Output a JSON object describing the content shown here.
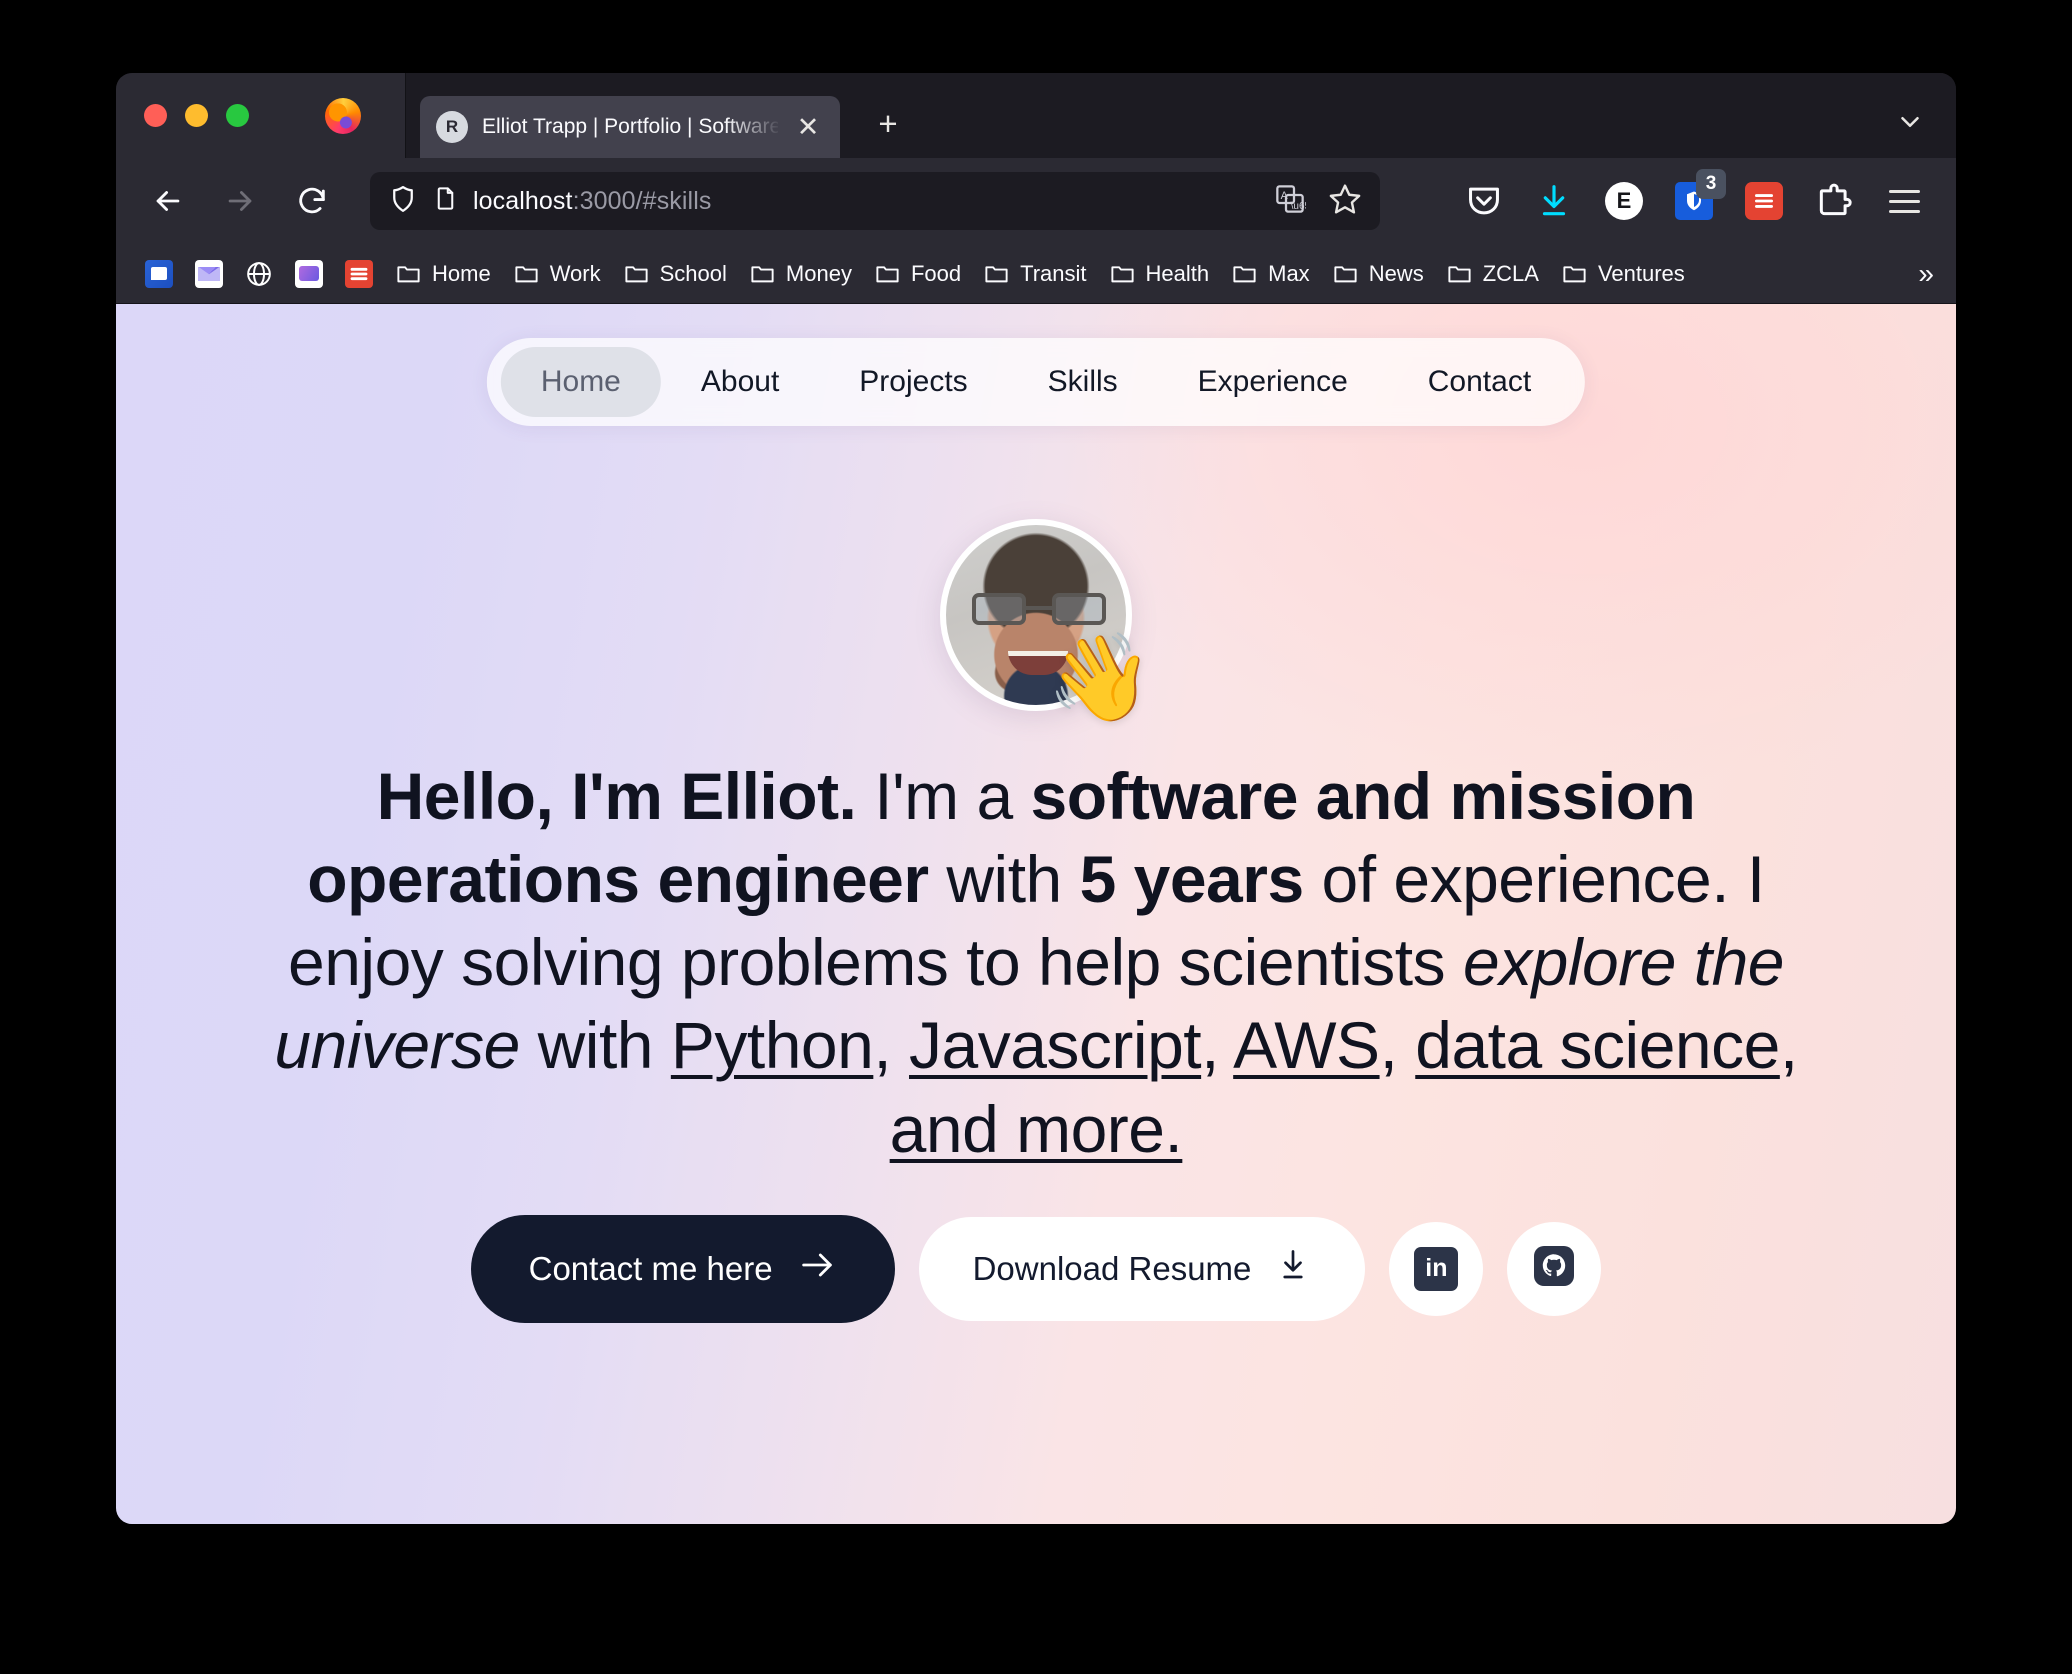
{
  "browser": {
    "window_controls": [
      "close",
      "minimize",
      "maximize"
    ],
    "tab": {
      "favicon_letter": "R",
      "title": "Elliot Trapp | Portfolio | Software",
      "close_label": "✕"
    },
    "new_tab_label": "+",
    "list_all_tabs_label": "⌄",
    "nav": {
      "back": "←",
      "forward": "→",
      "reload": "↻"
    },
    "url": {
      "host": "localhost",
      "rest": ":3000/#skills",
      "full": "localhost:3000/#skills"
    },
    "toolbar_icons": [
      {
        "name": "pocket-icon",
        "label": "Pocket"
      },
      {
        "name": "downloads-icon",
        "label": "Downloads"
      },
      {
        "name": "account-avatar",
        "label": "E"
      },
      {
        "name": "bitwarden-icon",
        "label": "Bitwarden",
        "badge": "3"
      },
      {
        "name": "todoist-icon",
        "label": "Todoist"
      },
      {
        "name": "extensions-icon",
        "label": "Extensions"
      },
      {
        "name": "app-menu-icon",
        "label": "Open application menu"
      }
    ],
    "bookmarks": {
      "favicons": [
        "slack-icon",
        "gmail-icon",
        "globe-icon",
        "photos-icon",
        "todoist-icon"
      ],
      "folders": [
        "Home",
        "Work",
        "School",
        "Money",
        "Food",
        "Transit",
        "Health",
        "Max",
        "News",
        "ZCLA",
        "Ventures"
      ],
      "overflow_label": "»"
    }
  },
  "site": {
    "nav": [
      {
        "label": "Home",
        "active": true
      },
      {
        "label": "About",
        "active": false
      },
      {
        "label": "Projects",
        "active": false
      },
      {
        "label": "Skills",
        "active": false
      },
      {
        "label": "Experience",
        "active": false
      },
      {
        "label": "Contact",
        "active": false
      }
    ],
    "avatar": {
      "emoji": "👋",
      "alt": "profile-photo"
    },
    "headline": {
      "p1": "Hello, I'm Elliot.",
      "p2": " I'm a ",
      "p3": "software and mission operations engineer",
      "p4": " with ",
      "p5": "5 years",
      "p6": " of experience. I enjoy solving problems to help scientists ",
      "p7": "explore the universe",
      "p8": " with ",
      "p9": "Python",
      "p10": ", ",
      "p11": "Javascript",
      "p12": ", ",
      "p13": "AWS",
      "p14": ", ",
      "p15": "data science",
      "p16": ", ",
      "p17": "and more."
    },
    "cta": {
      "primary": "Contact me here",
      "primary_icon": "→",
      "secondary": "Download Resume",
      "secondary_icon": "⤓",
      "linkedin": "in",
      "github": "github-icon"
    }
  },
  "colors": {
    "bg_left": "#dcd7f8",
    "bg_right": "#fbe2de",
    "primary_button": "#131a2e",
    "browser_chrome": "#2b2a33",
    "tabstrip": "#1c1b22",
    "active_tab": "#42414d",
    "downloads_accent": "#00ddff",
    "todoist_red": "#e44332",
    "bitwarden_blue": "#175ddc"
  }
}
